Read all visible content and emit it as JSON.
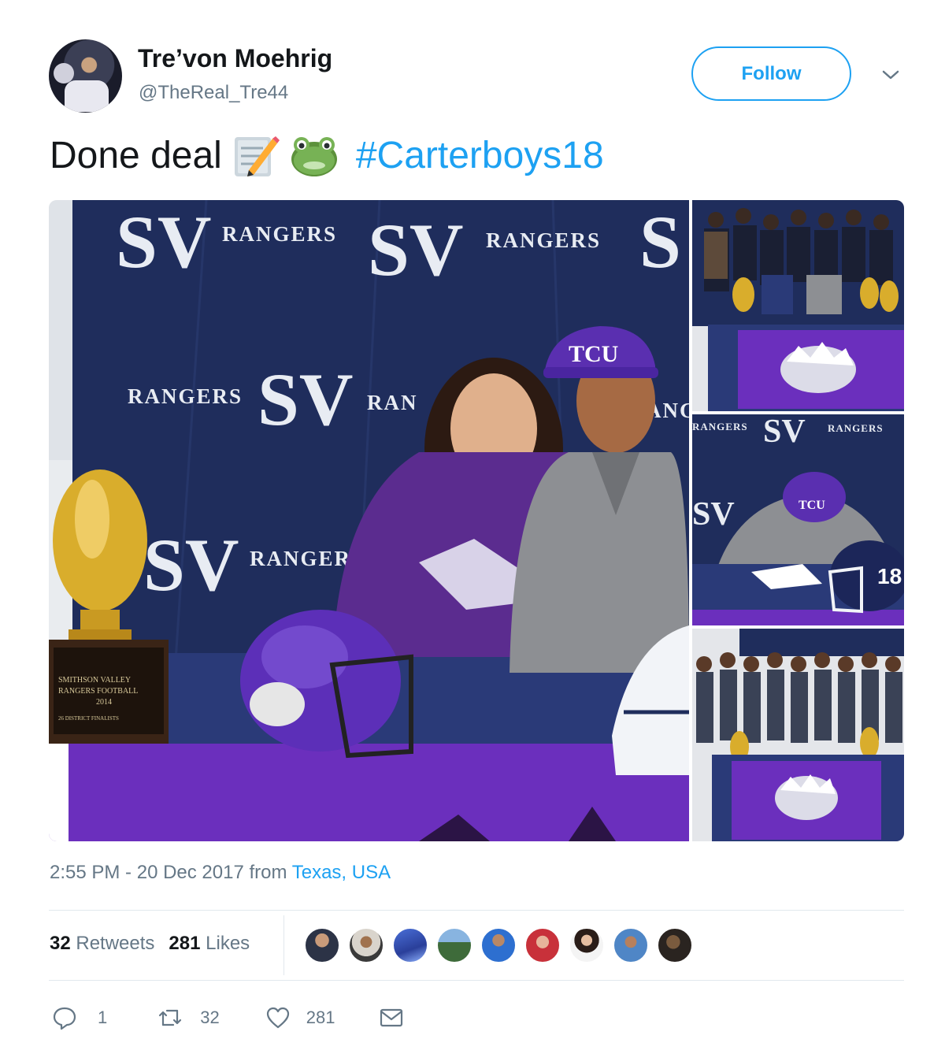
{
  "author": {
    "display_name": "Tre’von Moehrig",
    "handle": "@TheReal_Tre44",
    "follow_label": "Follow",
    "more_icon": "chevron-down-icon"
  },
  "tweet": {
    "text": "Done deal",
    "emoji": [
      "memo-emoji",
      "frog-emoji"
    ],
    "hashtag": "#Carterboys18"
  },
  "media": {
    "main_banner": [
      "RANGERS",
      "RANGERS",
      "RANGERS",
      "RAN",
      "ANG",
      "RANGERS"
    ],
    "trophy_plate": [
      "SMITHSON VALLEY",
      "RANGERS FOOTBALL",
      "2014",
      "26 DISTRICT FINALISTS"
    ],
    "cap_text": "TCU",
    "helmet_number": "18",
    "side_banner": [
      "RANGERS",
      "RANGERS"
    ]
  },
  "meta": {
    "time": "2:55 PM",
    "separator": " - ",
    "date": "20 Dec 2017",
    "from_label": " from ",
    "location": "Texas, USA"
  },
  "stats": {
    "retweets_count": "32",
    "retweets_label": " Retweets",
    "likes_count": "281",
    "likes_label": " Likes",
    "liker_count": 9
  },
  "actions": {
    "reply_count": "1",
    "retweet_count": "32",
    "like_count": "281"
  },
  "colors": {
    "accent": "#1da1f2",
    "secondary_text": "#657786",
    "divider": "#e1e8ed",
    "tcu_purple": "#4d1979",
    "banner_navy": "#1f2d5c"
  }
}
